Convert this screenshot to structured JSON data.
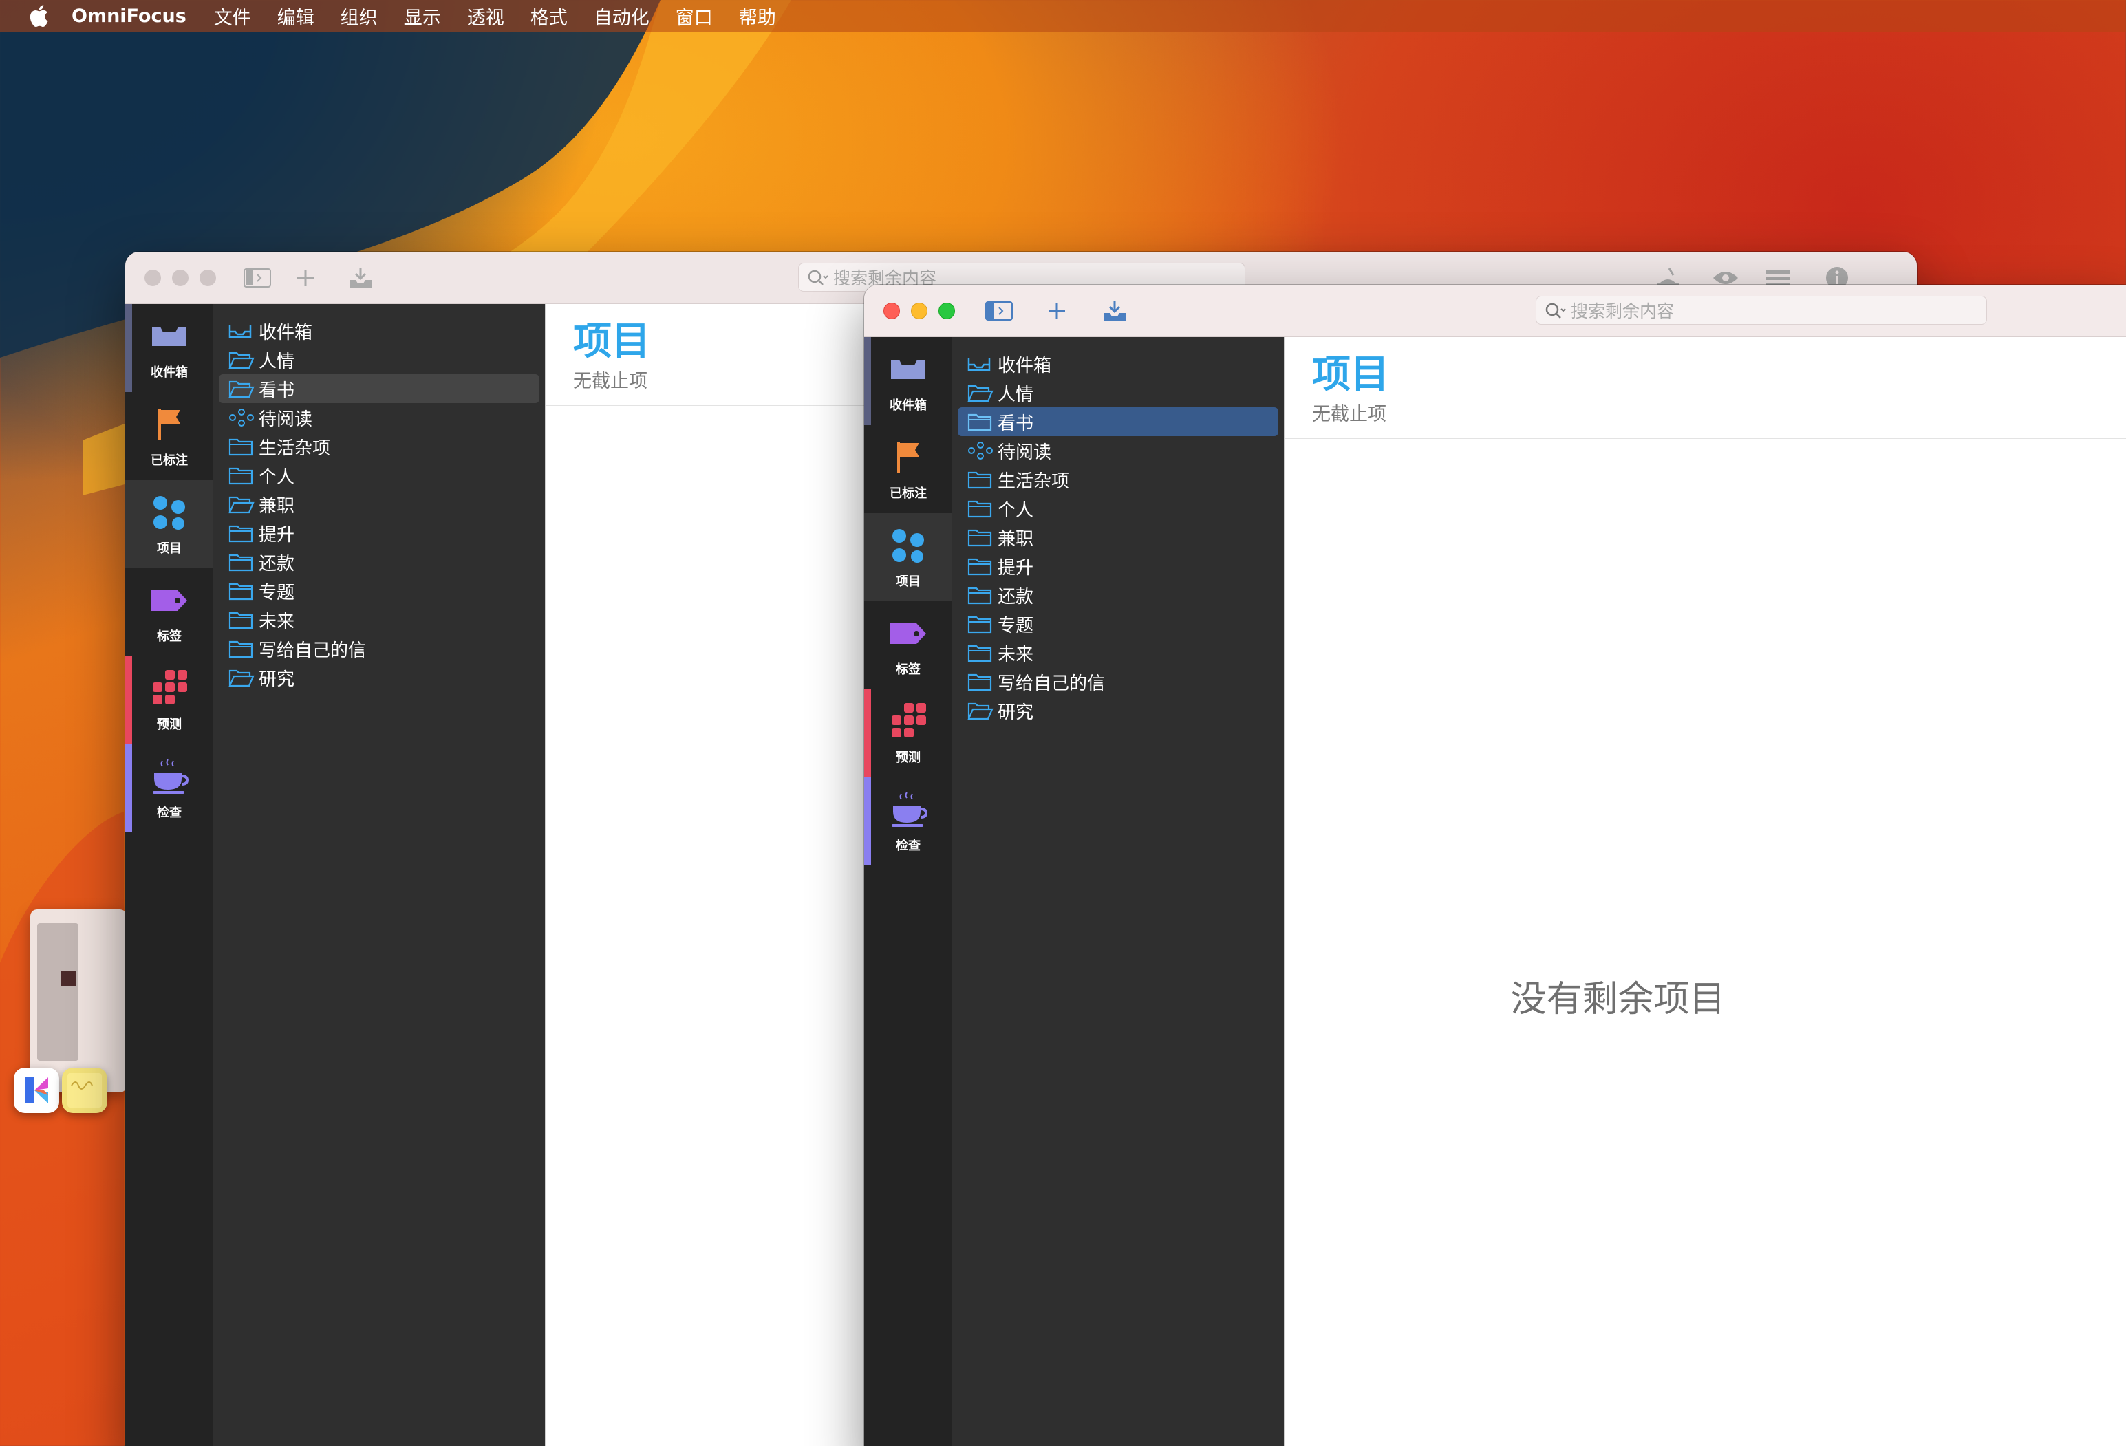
{
  "menubar": {
    "app_name": "OmniFocus",
    "items": [
      "文件",
      "编辑",
      "组织",
      "显示",
      "透视",
      "格式",
      "自动化",
      "窗口",
      "帮助"
    ]
  },
  "toolbar": {
    "search_placeholder": "搜索剩余内容"
  },
  "rail": {
    "items": [
      {
        "label": "收件箱",
        "icon": "inbox-icon",
        "color": "#8e9ad8"
      },
      {
        "label": "已标注",
        "icon": "flag-icon",
        "color": "#f08a3c"
      },
      {
        "label": "项目",
        "icon": "projects-icon",
        "color": "#3aa8ee"
      },
      {
        "label": "标签",
        "icon": "tag-icon",
        "color": "#a35ee8"
      },
      {
        "label": "预测",
        "icon": "forecast-icon",
        "color": "#e8475f"
      },
      {
        "label": "检查",
        "icon": "review-icon",
        "color": "#8a7ff0"
      }
    ]
  },
  "sidebar": {
    "items": [
      {
        "label": "收件箱",
        "icon": "inbox-icon"
      },
      {
        "label": "人情",
        "icon": "folder-open-icon"
      },
      {
        "label": "看书",
        "icon": "folder-open-icon"
      },
      {
        "label": "待阅读",
        "icon": "sequential-project-icon"
      },
      {
        "label": "生活杂项",
        "icon": "folder-icon"
      },
      {
        "label": "个人",
        "icon": "folder-icon"
      },
      {
        "label": "兼职",
        "icon": "folder-open-icon"
      },
      {
        "label": "提升",
        "icon": "folder-icon"
      },
      {
        "label": "还款",
        "icon": "folder-icon"
      },
      {
        "label": "专题",
        "icon": "folder-icon"
      },
      {
        "label": "未来",
        "icon": "folder-icon"
      },
      {
        "label": "写给自己的信",
        "icon": "folder-icon"
      },
      {
        "label": "研究",
        "icon": "folder-open-icon"
      }
    ]
  },
  "content": {
    "title": "项目",
    "subtitle": "无截止项",
    "empty_message": "没有剩余项目"
  },
  "colors": {
    "accent": "#2ea6ea",
    "sidebar_bg": "#2f2f2f",
    "rail_bg": "#232323",
    "selection_blue": "#385b8c"
  }
}
